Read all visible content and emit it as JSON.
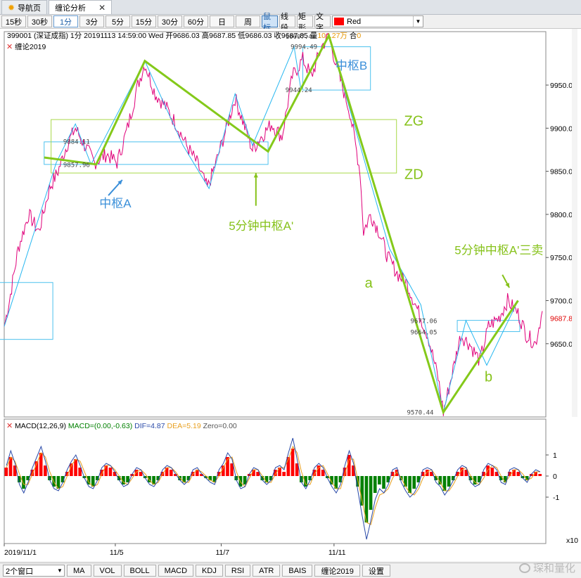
{
  "tabs": [
    {
      "label": "导航页",
      "icon": "sun-icon"
    },
    {
      "label": "缠论分析",
      "icon": ""
    }
  ],
  "toolbar": {
    "periods": [
      "15秒",
      "30秒",
      "1分",
      "3分",
      "5分",
      "15分",
      "30分",
      "60分",
      "日",
      "周"
    ],
    "selected_period": "1分",
    "tools": [
      "鼠标",
      "线段",
      "矩形",
      "文字"
    ],
    "selected_tool": "鼠标",
    "color_label": "Red",
    "color_value": "#ff0000"
  },
  "quote": {
    "symbol": "399001",
    "name": "(深证成指)",
    "period": "1分",
    "datetime": "20191113 14:59:00 Wed",
    "open_label": "开",
    "open": "9686.03",
    "high_label": "高",
    "high": "9687.85",
    "low_label": "低",
    "low": "9686.03",
    "close_label": "收",
    "close": "9687.85",
    "vol_label": "量",
    "vol": "104.27万",
    "oi_label": "合",
    "oi": "0"
  },
  "indicator_label": "缠论2019",
  "macd": {
    "name": "MACD(12,26,9)",
    "macd_text": "MACD=(0.00,-0.63)",
    "dif_text": "DIF=4.87",
    "dea_text": "DEA=5.19",
    "zero_text": "Zero=0.00"
  },
  "scale_label": "x10",
  "bottom": {
    "window_select": "2个窗口",
    "buttons": [
      "MA",
      "VOL",
      "BOLL",
      "MACD",
      "KDJ",
      "RSI",
      "ATR",
      "BAIS",
      "缠论2019",
      "设置"
    ],
    "watermark": "琛和量化"
  },
  "colors": {
    "price_line": "#e0007a",
    "bi_line": "#27b7f0",
    "segment_line": "#84c91a",
    "hub_box": "#4cc1ee",
    "zg_zd_box": "#a8d848",
    "annotation_blue": "#3a8fd9",
    "annotation_green": "#86c21a",
    "macd_up": "#ff0000",
    "macd_down": "#008000",
    "dif_line": "#2a4aa8",
    "dea_line": "#e8a020"
  },
  "chart_data": {
    "type": "line",
    "x_tick_labels": [
      "2019/11/1",
      "11/5",
      "11/7",
      "11/11"
    ],
    "y_ticks": [
      9650,
      9700,
      9750,
      9800,
      9850,
      9900,
      9950
    ],
    "y_tick_labels": [
      "9650.00",
      "9700.00",
      "9750.00",
      "9800.00",
      "9850.00",
      "9900.00",
      "9950.00"
    ],
    "ylim": [
      9565,
      10012
    ],
    "last_price": 9687.85,
    "last_price_label": "9687.85",
    "price_points": [
      {
        "t": 0,
        "y": 9670
      },
      {
        "t": 3,
        "y": 9700
      },
      {
        "t": 8,
        "y": 9760
      },
      {
        "t": 14,
        "y": 9800
      },
      {
        "t": 20,
        "y": 9780
      },
      {
        "t": 26,
        "y": 9830
      },
      {
        "t": 31,
        "y": 9850
      },
      {
        "t": 36,
        "y": 9880
      },
      {
        "t": 41,
        "y": 9900
      },
      {
        "t": 45,
        "y": 9885
      },
      {
        "t": 52,
        "y": 9860
      },
      {
        "t": 59,
        "y": 9870
      },
      {
        "t": 65,
        "y": 9860
      },
      {
        "t": 71,
        "y": 9900
      },
      {
        "t": 77,
        "y": 9950
      },
      {
        "t": 81,
        "y": 9975
      },
      {
        "t": 87,
        "y": 9940
      },
      {
        "t": 93,
        "y": 9925
      },
      {
        "t": 99,
        "y": 9905
      },
      {
        "t": 105,
        "y": 9880
      },
      {
        "t": 111,
        "y": 9860
      },
      {
        "t": 117,
        "y": 9830
      },
      {
        "t": 122,
        "y": 9860
      },
      {
        "t": 128,
        "y": 9900
      },
      {
        "t": 133,
        "y": 9935
      },
      {
        "t": 138,
        "y": 9905
      },
      {
        "t": 143,
        "y": 9875
      },
      {
        "t": 148,
        "y": 9890
      },
      {
        "t": 154,
        "y": 9905
      },
      {
        "t": 160,
        "y": 9890
      },
      {
        "t": 166,
        "y": 9960
      },
      {
        "t": 172,
        "y": 9980
      },
      {
        "t": 177,
        "y": 9960
      },
      {
        "t": 183,
        "y": 9995
      },
      {
        "t": 187,
        "y": 10007.41
      },
      {
        "t": 193,
        "y": 9960
      },
      {
        "t": 199,
        "y": 9920
      },
      {
        "t": 205,
        "y": 9850
      },
      {
        "t": 207,
        "y": 9780
      },
      {
        "t": 211,
        "y": 9800
      },
      {
        "t": 216,
        "y": 9780
      },
      {
        "t": 221,
        "y": 9750
      },
      {
        "t": 227,
        "y": 9730
      },
      {
        "t": 232,
        "y": 9720
      },
      {
        "t": 238,
        "y": 9690
      },
      {
        "t": 244,
        "y": 9660
      },
      {
        "t": 250,
        "y": 9610
      },
      {
        "t": 253,
        "y": 9570.44
      },
      {
        "t": 258,
        "y": 9615
      },
      {
        "t": 263,
        "y": 9660
      },
      {
        "t": 268,
        "y": 9650
      },
      {
        "t": 274,
        "y": 9630
      },
      {
        "t": 279,
        "y": 9670
      },
      {
        "t": 285,
        "y": 9680
      },
      {
        "t": 290,
        "y": 9700
      },
      {
        "t": 296,
        "y": 9685
      },
      {
        "t": 301,
        "y": 9660
      },
      {
        "t": 306,
        "y": 9650
      },
      {
        "t": 310,
        "y": 9687.85
      }
    ],
    "bi_points": [
      {
        "t": 0,
        "y": 9670
      },
      {
        "t": 30,
        "y": 9860
      },
      {
        "t": 41,
        "y": 9905
      },
      {
        "t": 50,
        "y": 9858
      },
      {
        "t": 81,
        "y": 9978
      },
      {
        "t": 103,
        "y": 9880
      },
      {
        "t": 118,
        "y": 9830
      },
      {
        "t": 133,
        "y": 9940
      },
      {
        "t": 143,
        "y": 9880
      },
      {
        "t": 167,
        "y": 9994.49
      },
      {
        "t": 171,
        "y": 9944.24
      },
      {
        "t": 187,
        "y": 10007.41
      },
      {
        "t": 222,
        "y": 9760
      },
      {
        "t": 240,
        "y": 9695
      },
      {
        "t": 253,
        "y": 9570.44
      },
      {
        "t": 266,
        "y": 9677
      },
      {
        "t": 278,
        "y": 9625
      },
      {
        "t": 296,
        "y": 9700
      }
    ],
    "segment_points": [
      {
        "t": 23,
        "y": 9866
      },
      {
        "t": 53,
        "y": 9857.96
      },
      {
        "t": 81,
        "y": 9978
      },
      {
        "t": 152,
        "y": 9873
      },
      {
        "t": 187,
        "y": 10007.41
      },
      {
        "t": 253,
        "y": 9570.44
      },
      {
        "t": 296,
        "y": 9700
      }
    ],
    "hubs": [
      {
        "name": "中枢A",
        "t0": 23,
        "t1": 152,
        "y_low": 9857.96,
        "y_high": 9884.11
      },
      {
        "name": "中枢B",
        "t0": 172,
        "t1": 211,
        "y_low": 9944.24,
        "y_high": 9994.49
      },
      {
        "name": "ZG/ZD",
        "t0": 27,
        "t1": 226,
        "y_low": 9848,
        "y_high": 9910
      },
      {
        "name": "lower-hub",
        "t0": 261,
        "t1": 297,
        "y_low": 9664.05,
        "y_high": 9677.06
      },
      {
        "name": "left-box",
        "t0": -3,
        "t1": 28,
        "y_low": 9655,
        "y_high": 9721
      }
    ],
    "price_labels": [
      {
        "text": "10007.41",
        "t": 162,
        "y": 10004
      },
      {
        "text": "9994.49",
        "t": 165,
        "y": 9992
      },
      {
        "text": "9944.24",
        "t": 162,
        "y": 9942
      },
      {
        "text": "9884.11",
        "t": 34,
        "y": 9882
      },
      {
        "text": "9857.96",
        "t": 34,
        "y": 9855
      },
      {
        "text": "9677.06",
        "t": 234,
        "y": 9674
      },
      {
        "text": "9664.05",
        "t": 234,
        "y": 9661
      },
      {
        "text": "9570.44",
        "t": 232,
        "y": 9568
      }
    ],
    "annotations": [
      {
        "text": "中枢B",
        "t": 200,
        "y": 9968,
        "color": "blue"
      },
      {
        "text": "ZG",
        "t": 236,
        "y": 9903,
        "color": "green"
      },
      {
        "text": "ZD",
        "t": 236,
        "y": 9841,
        "color": "green"
      },
      {
        "text": "中枢A",
        "t": 64,
        "y": 9808,
        "color": "blue"
      },
      {
        "text": "5分钟中枢A'",
        "t": 148,
        "y": 9782,
        "color": "green"
      },
      {
        "text": "5分钟中枢A'三卖",
        "t": 285,
        "y": 9754,
        "color": "green"
      },
      {
        "text": "a",
        "t": 210,
        "y": 9715,
        "color": "green"
      },
      {
        "text": "b",
        "t": 279,
        "y": 9606,
        "color": "green"
      }
    ],
    "macd_ylim": [
      -3.2,
      2.1
    ],
    "macd_ticks": [
      1,
      0,
      -1
    ],
    "macd_tick_labels": [
      "1",
      "0",
      "-1"
    ],
    "macd_hist": [
      0.4,
      0.9,
      0.5,
      -0.3,
      -0.6,
      -0.2,
      0.3,
      0.7,
      1.1,
      0.5,
      -0.2,
      -0.5,
      -0.6,
      -0.3,
      0.2,
      0.6,
      0.8,
      0.4,
      -0.1,
      -0.4,
      -0.5,
      -0.2,
      0.3,
      0.5,
      0.4,
      0.2,
      -0.2,
      -0.4,
      -0.3,
      0.1,
      0.3,
      0.2,
      -0.1,
      -0.3,
      -0.4,
      -0.2,
      0.2,
      0.4,
      0.3,
      0.1,
      -0.2,
      -0.3,
      -0.2,
      0.2,
      0.3,
      0.1,
      -0.1,
      -0.2,
      -0.3,
      0.2,
      0.5,
      0.9,
      0.6,
      -0.2,
      -0.5,
      -0.4,
      0.1,
      0.3,
      0.2,
      -0.2,
      -0.3,
      -0.2,
      0.3,
      0.4,
      0.2,
      0.9,
      1.3,
      0.6,
      -0.3,
      -0.5,
      -0.2,
      0.3,
      0.5,
      0.3,
      -0.1,
      -0.4,
      -0.6,
      -0.3,
      0.4,
      1.0,
      0.5,
      -0.5,
      -1.4,
      -2.2,
      -1.6,
      -0.8,
      -0.4,
      -0.6,
      -0.3,
      0.2,
      0.3,
      -0.2,
      -0.5,
      -0.8,
      -0.6,
      -0.3,
      0.2,
      0.3,
      0.2,
      -0.2,
      -0.4,
      -0.7,
      -0.5,
      -0.2,
      0.2,
      0.4,
      0.3,
      -0.2,
      -0.4,
      -0.3,
      0.2,
      0.5,
      0.4,
      0.2,
      -0.2,
      -0.3,
      0.2,
      0.3,
      0.2,
      -0.1,
      -0.2,
      0.1,
      0.2,
      0.1
    ],
    "macd_dif": [
      0.5,
      1.2,
      0.6,
      -0.4,
      -0.8,
      -0.3,
      0.4,
      0.9,
      1.4,
      0.7,
      -0.2,
      -0.6,
      -0.7,
      -0.3,
      0.3,
      0.7,
      1.0,
      0.5,
      -0.1,
      -0.5,
      -0.6,
      -0.2,
      0.4,
      0.6,
      0.5,
      0.2,
      -0.2,
      -0.5,
      -0.4,
      0.1,
      0.4,
      0.3,
      -0.1,
      -0.4,
      -0.5,
      -0.2,
      0.3,
      0.5,
      0.4,
      0.1,
      -0.2,
      -0.4,
      -0.2,
      0.3,
      0.4,
      0.1,
      -0.1,
      -0.3,
      -0.4,
      0.3,
      0.6,
      1.1,
      0.8,
      -0.2,
      -0.6,
      -0.5,
      0.1,
      0.4,
      0.3,
      -0.2,
      -0.4,
      -0.2,
      0.4,
      0.5,
      0.3,
      1.1,
      1.8,
      0.8,
      -0.3,
      -0.6,
      -0.2,
      0.4,
      0.6,
      0.4,
      -0.1,
      -0.5,
      -0.8,
      -0.4,
      0.5,
      1.2,
      0.6,
      -0.7,
      -1.9,
      -3.0,
      -2.1,
      -1.1,
      -0.6,
      -0.8,
      -0.4,
      0.3,
      0.4,
      -0.3,
      -0.7,
      -1.0,
      -0.8,
      -0.4,
      0.3,
      0.4,
      0.3,
      -0.3,
      -0.5,
      -0.9,
      -0.6,
      -0.2,
      0.3,
      0.5,
      0.4,
      -0.3,
      -0.5,
      -0.4,
      0.3,
      0.6,
      0.5,
      0.3,
      -0.3,
      -0.4,
      0.3,
      0.4,
      0.3,
      -0.1,
      -0.3,
      0.1,
      0.3,
      0.2
    ],
    "macd_dea": [
      0.4,
      0.9,
      0.7,
      0.1,
      -0.4,
      -0.4,
      0.1,
      0.6,
      1.1,
      0.9,
      0.2,
      -0.3,
      -0.6,
      -0.5,
      0.0,
      0.5,
      0.8,
      0.7,
      0.2,
      -0.3,
      -0.5,
      -0.4,
      0.1,
      0.5,
      0.5,
      0.3,
      0.0,
      -0.3,
      -0.4,
      -0.1,
      0.2,
      0.3,
      0.1,
      -0.2,
      -0.4,
      -0.3,
      0.1,
      0.4,
      0.4,
      0.2,
      -0.1,
      -0.3,
      -0.3,
      0.1,
      0.3,
      0.2,
      0.0,
      -0.2,
      -0.3,
      0.0,
      0.4,
      0.8,
      0.9,
      0.2,
      -0.3,
      -0.5,
      -0.1,
      0.3,
      0.3,
      0.0,
      -0.3,
      -0.3,
      0.1,
      0.4,
      0.4,
      0.8,
      1.4,
      1.1,
      0.2,
      -0.4,
      -0.4,
      0.1,
      0.4,
      0.5,
      0.1,
      -0.3,
      -0.6,
      -0.6,
      0.1,
      0.8,
      0.8,
      -0.2,
      -1.2,
      -2.2,
      -2.3,
      -1.5,
      -0.9,
      -0.8,
      -0.6,
      -0.1,
      0.2,
      -0.1,
      -0.5,
      -0.8,
      -0.9,
      -0.6,
      -0.1,
      0.2,
      0.3,
      0.0,
      -0.3,
      -0.7,
      -0.7,
      -0.4,
      0.0,
      0.3,
      0.4,
      0.0,
      -0.3,
      -0.4,
      -0.1,
      0.3,
      0.5,
      0.4,
      0.0,
      -0.3,
      0.0,
      0.3,
      0.3,
      0.1,
      -0.2,
      -0.1,
      0.2,
      0.2
    ]
  }
}
